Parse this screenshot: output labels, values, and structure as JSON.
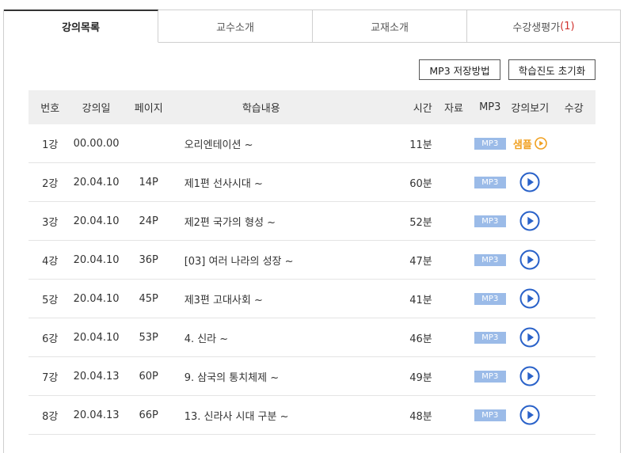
{
  "tabs": [
    {
      "label": "강의목록",
      "count": ""
    },
    {
      "label": "교수소개",
      "count": ""
    },
    {
      "label": "교재소개",
      "count": ""
    },
    {
      "label": "수강생평가",
      "count": "(1)"
    }
  ],
  "buttons": {
    "mp3_guide": "MP3 저장방법",
    "reset_progress": "학습진도 초기화"
  },
  "table": {
    "headers": {
      "no": "번호",
      "date": "강의일",
      "page": "페이지",
      "title": "학습내용",
      "time": "시간",
      "file": "자료",
      "mp3": "MP3",
      "view": "강의보기",
      "reg": "수강"
    },
    "rows": [
      {
        "no": "1강",
        "date": "00.00.00",
        "page": "",
        "title": "오리엔테이션 ~",
        "time": "11분",
        "mp3": "MP3",
        "view": "sample",
        "sample_label": "샘플"
      },
      {
        "no": "2강",
        "date": "20.04.10",
        "page": "14P",
        "title": "제1편 선사시대 ~",
        "time": "60분",
        "mp3": "MP3",
        "view": "play"
      },
      {
        "no": "3강",
        "date": "20.04.10",
        "page": "24P",
        "title": "제2편 국가의 형성 ~",
        "time": "52분",
        "mp3": "MP3",
        "view": "play"
      },
      {
        "no": "4강",
        "date": "20.04.10",
        "page": "36P",
        "title": "[03] 여러 나라의 성장 ~",
        "time": "47분",
        "mp3": "MP3",
        "view": "play"
      },
      {
        "no": "5강",
        "date": "20.04.10",
        "page": "45P",
        "title": "제3편 고대사회 ~",
        "time": "41분",
        "mp3": "MP3",
        "view": "play"
      },
      {
        "no": "6강",
        "date": "20.04.10",
        "page": "53P",
        "title": "4. 신라 ~",
        "time": "46분",
        "mp3": "MP3",
        "view": "play"
      },
      {
        "no": "7강",
        "date": "20.04.13",
        "page": "60P",
        "title": "9. 삼국의 통치체제 ~",
        "time": "49분",
        "mp3": "MP3",
        "view": "play"
      },
      {
        "no": "8강",
        "date": "20.04.13",
        "page": "66P",
        "title": "13. 신라사 시대 구분 ~",
        "time": "48분",
        "mp3": "MP3",
        "view": "play"
      }
    ]
  },
  "colors": {
    "play_icon": "#2a62c9",
    "sample_icon": "#f0a020",
    "mp3_badge": "#9bbbe8",
    "count_accent": "#d0312d"
  },
  "icons": {
    "play": "play-circle-icon",
    "sample": "sample-play-icon"
  }
}
